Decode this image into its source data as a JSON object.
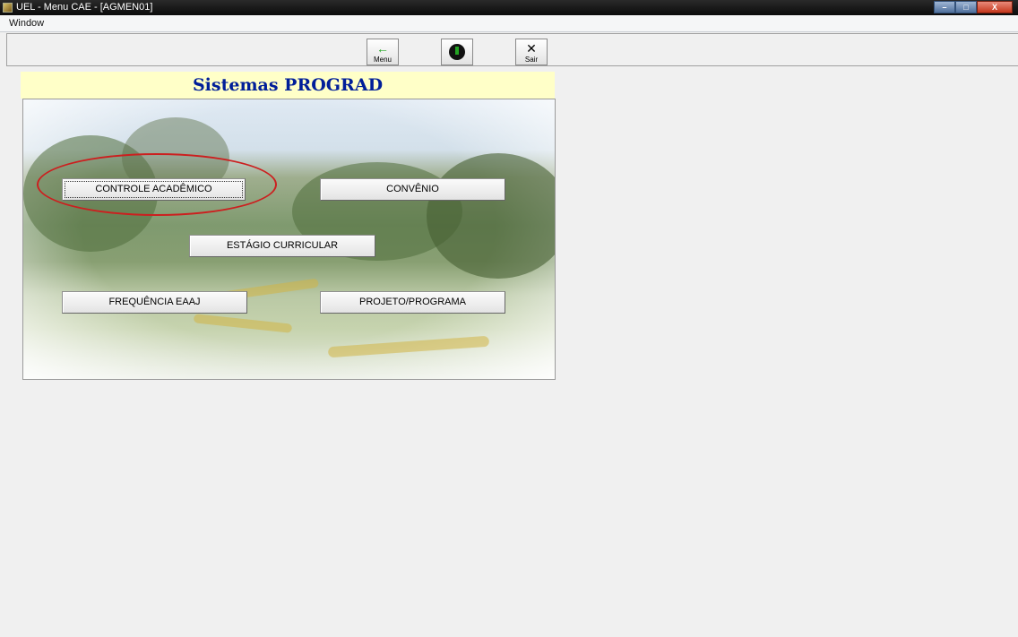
{
  "window": {
    "title": "UEL - Menu CAE - [AGMEN01]",
    "controls": [
      "–",
      "□",
      "X"
    ]
  },
  "menubar": {
    "items": [
      "Window"
    ]
  },
  "toolbar": {
    "menu_label": "Menu",
    "sair_label": "Sair",
    "menu_icon": "←",
    "sair_icon": "✕"
  },
  "panel": {
    "title": "Sistemas PROGRAD",
    "buttons": {
      "controle": "CONTROLE ACADÊMICO",
      "convenio": "CONVÊNIO",
      "estagio": "ESTÁGIO CURRICULAR",
      "frequencia": "FREQUÊNCIA EAAJ",
      "projeto": "PROJETO/PROGRAMA"
    }
  },
  "colors": {
    "title_text": "#001e99",
    "title_bg": "#ffffc8",
    "highlight_ellipse": "#cc1f1f"
  }
}
